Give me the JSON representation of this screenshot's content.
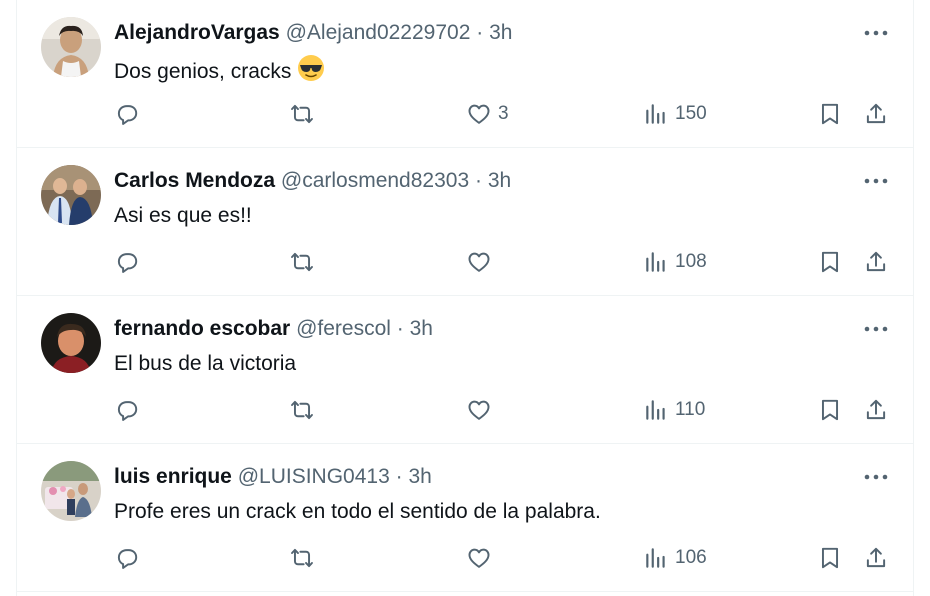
{
  "tweets": [
    {
      "name": "AlejandroVargas",
      "handle": "@Alejand02229702",
      "separator": "·",
      "time": "3h",
      "text": "Dos genios, cracks",
      "emoji": "sunglasses-emoji",
      "likes": "3",
      "views": "150",
      "avatar": "avatar-photo-young-man-tank-top"
    },
    {
      "name": "Carlos Mendoza",
      "handle": "@carlosmend82303",
      "separator": "·",
      "time": "3h",
      "text": "Asi es que es!!",
      "likes": "",
      "views": "108",
      "avatar": "avatar-photo-two-men-suits"
    },
    {
      "name": "fernando escobar",
      "handle": "@ferescol",
      "separator": "·",
      "time": "3h",
      "text": "El bus de la victoria",
      "likes": "",
      "views": "110",
      "avatar": "avatar-photo-man-portrait"
    },
    {
      "name": "luis enrique",
      "handle": "@LUISING0413",
      "separator": "·",
      "time": "3h",
      "text": "Profe eres un crack en todo el sentido de la palabra.",
      "likes": "",
      "views": "106",
      "avatar": "avatar-photo-group-celebration"
    }
  ],
  "icons": {
    "more": "more-horizontal-icon",
    "reply": "reply-icon",
    "retweet": "retweet-icon",
    "like": "heart-icon",
    "views": "views-chart-icon",
    "bookmark": "bookmark-icon",
    "share": "share-icon"
  },
  "colors": {
    "text_primary": "#0f1419",
    "text_secondary": "#536471",
    "divider": "#eff3f4"
  }
}
